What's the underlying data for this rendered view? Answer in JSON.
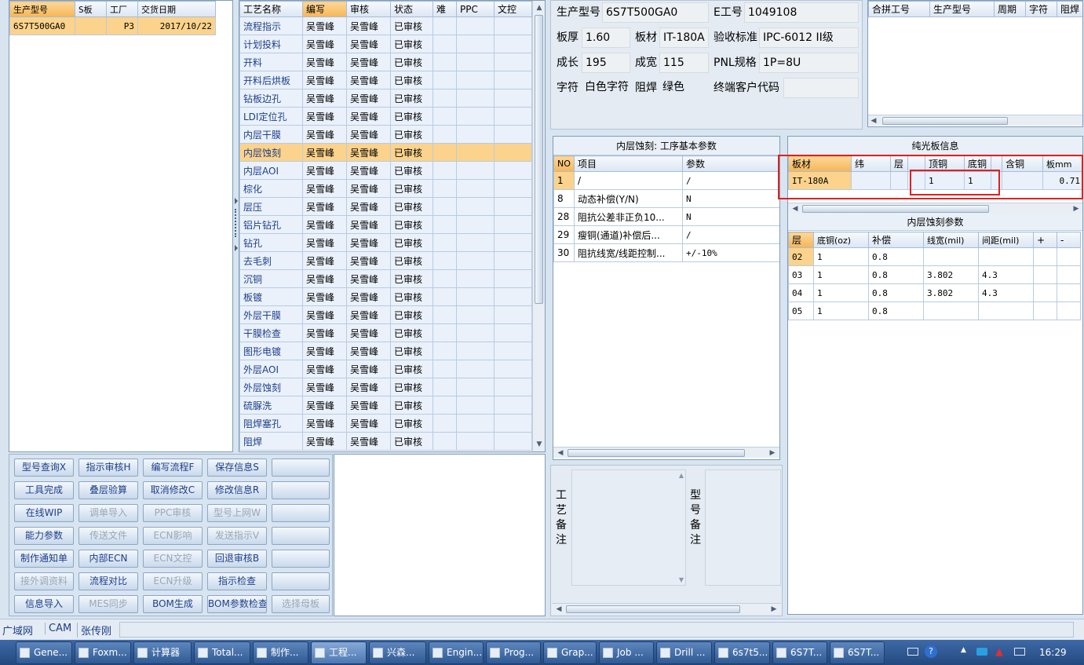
{
  "model_list": {
    "headers": [
      "生产型号",
      "S板",
      "工厂",
      "交货日期"
    ],
    "rows": [
      {
        "model": "6S7T500GA0",
        "s_board": "",
        "factory": "P3",
        "date": "2017/10/22"
      }
    ]
  },
  "process": {
    "headers": [
      "工艺名称",
      "编写",
      "审核",
      "状态",
      "难",
      "PPC",
      "文控"
    ],
    "rows": [
      {
        "name": "流程指示",
        "writer": "吴雪峰",
        "reviewer": "吴雪峰",
        "status": "已审核"
      },
      {
        "name": "计划投料",
        "writer": "吴雪峰",
        "reviewer": "吴雪峰",
        "status": "已审核"
      },
      {
        "name": "开料",
        "writer": "吴雪峰",
        "reviewer": "吴雪峰",
        "status": "已审核"
      },
      {
        "name": "开料后烘板",
        "writer": "吴雪峰",
        "reviewer": "吴雪峰",
        "status": "已审核"
      },
      {
        "name": "钻板边孔",
        "writer": "吴雪峰",
        "reviewer": "吴雪峰",
        "status": "已审核"
      },
      {
        "name": "LDI定位孔",
        "writer": "吴雪峰",
        "reviewer": "吴雪峰",
        "status": "已审核"
      },
      {
        "name": "内层干膜",
        "writer": "吴雪峰",
        "reviewer": "吴雪峰",
        "status": "已审核"
      },
      {
        "name": "内层蚀刻",
        "writer": "吴雪峰",
        "reviewer": "吴雪峰",
        "status": "已审核"
      },
      {
        "name": "内层AOI",
        "writer": "吴雪峰",
        "reviewer": "吴雪峰",
        "status": "已审核"
      },
      {
        "name": "棕化",
        "writer": "吴雪峰",
        "reviewer": "吴雪峰",
        "status": "已审核"
      },
      {
        "name": "层压",
        "writer": "吴雪峰",
        "reviewer": "吴雪峰",
        "status": "已审核"
      },
      {
        "name": "铝片钻孔",
        "writer": "吴雪峰",
        "reviewer": "吴雪峰",
        "status": "已审核"
      },
      {
        "name": "钻孔",
        "writer": "吴雪峰",
        "reviewer": "吴雪峰",
        "status": "已审核"
      },
      {
        "name": "去毛刺",
        "writer": "吴雪峰",
        "reviewer": "吴雪峰",
        "status": "已审核"
      },
      {
        "name": "沉铜",
        "writer": "吴雪峰",
        "reviewer": "吴雪峰",
        "status": "已审核"
      },
      {
        "name": "板镀",
        "writer": "吴雪峰",
        "reviewer": "吴雪峰",
        "status": "已审核"
      },
      {
        "name": "外层干膜",
        "writer": "吴雪峰",
        "reviewer": "吴雪峰",
        "status": "已审核"
      },
      {
        "name": "干膜检查",
        "writer": "吴雪峰",
        "reviewer": "吴雪峰",
        "status": "已审核"
      },
      {
        "name": "图形电镀",
        "writer": "吴雪峰",
        "reviewer": "吴雪峰",
        "status": "已审核"
      },
      {
        "name": "外层AOI",
        "writer": "吴雪峰",
        "reviewer": "吴雪峰",
        "status": "已审核"
      },
      {
        "name": "外层蚀刻",
        "writer": "吴雪峰",
        "reviewer": "吴雪峰",
        "status": "已审核"
      },
      {
        "name": "硫脲洗",
        "writer": "吴雪峰",
        "reviewer": "吴雪峰",
        "status": "已审核"
      },
      {
        "name": "阻焊塞孔",
        "writer": "吴雪峰",
        "reviewer": "吴雪峰",
        "status": "已审核"
      },
      {
        "name": "阻焊",
        "writer": "吴雪峰",
        "reviewer": "吴雪峰",
        "status": "已审核"
      }
    ]
  },
  "buttons": [
    [
      "型号查询X",
      "指示审核H",
      "编写流程F",
      "保存信息S",
      ""
    ],
    [
      "工具完成",
      "叠层验算",
      "取消修改C",
      "修改信息R",
      ""
    ],
    [
      "在线WIP",
      "调单导入",
      "PPC审核",
      "型号上网W",
      ""
    ],
    [
      "能力参数",
      "传送文件",
      "ECN影响",
      "发送指示V",
      ""
    ],
    [
      "制作通知单",
      "内部ECN",
      "ECN文控",
      "回退审核B",
      ""
    ],
    [
      "接外调资料",
      "流程对比",
      "ECN升级",
      "指示检查",
      ""
    ],
    [
      "信息导入",
      "MES同步",
      "BOM生成",
      "BOM参数检查",
      "选择母板"
    ]
  ],
  "info": {
    "prod_model_label": "生产型号",
    "prod_model": "6S7T500GA0",
    "e_no_label": "E工号",
    "e_no": "1049108",
    "thickness_label": "板厚",
    "thickness": "1.60",
    "material_label": "板材",
    "material": "IT-180A",
    "standard_label": "验收标准",
    "standard": "IPC-6012 II级",
    "length_label": "成长",
    "length": "195",
    "width_label": "成宽",
    "width": "115",
    "pnl_label": "PNL规格",
    "pnl": "1P=8U",
    "char_label": "字符",
    "char": "白色字符",
    "mask_label": "阻焊",
    "mask": "绿色",
    "customer_label": "终端客户代码",
    "customer": ""
  },
  "merge_table": {
    "headers": [
      "合拼工号",
      "生产型号",
      "周期",
      "字符",
      "阻焊"
    ]
  },
  "params": {
    "title": "内层蚀刻: 工序基本参数",
    "headers": [
      "NO",
      "项目",
      "参数"
    ],
    "rows": [
      {
        "no": "1",
        "item": "/",
        "value": "/"
      },
      {
        "no": "8",
        "item": "动态补偿(Y/N)",
        "value": "N"
      },
      {
        "no": "28",
        "item": "阻抗公差非正负10...",
        "value": "N"
      },
      {
        "no": "29",
        "item": "瘦铜(通道)补偿后...",
        "value": "/"
      },
      {
        "no": "30",
        "item": "阻抗线宽/线距控制...",
        "value": "+/-10%"
      }
    ]
  },
  "laminate": {
    "title": "纯光板信息",
    "headers": [
      "板材",
      "纬",
      "层",
      "",
      "顶铜",
      "底铜",
      "",
      "含铜",
      "板mm"
    ],
    "row": [
      "IT-180A",
      "",
      "",
      "",
      "1",
      "1",
      "",
      "",
      "0.71"
    ]
  },
  "etch": {
    "title": "内层蚀刻参数",
    "headers": [
      "层",
      "底铜(oz)",
      "补偿",
      "线宽(mil)",
      "间距(mil)",
      "+",
      "-"
    ],
    "rows": [
      [
        "02",
        "1",
        "0.8",
        "",
        "",
        "",
        ""
      ],
      [
        "03",
        "1",
        "0.8",
        "3.802",
        "4.3",
        "",
        ""
      ],
      [
        "04",
        "1",
        "0.8",
        "3.802",
        "4.3",
        "",
        ""
      ],
      [
        "05",
        "1",
        "0.8",
        "",
        "",
        "",
        ""
      ]
    ]
  },
  "remarks": {
    "process_label": "工艺备注",
    "model_label": "型号备注"
  },
  "status_bar": [
    "广域网",
    "CAM",
    "张传刚"
  ],
  "taskbar": {
    "items": [
      "Gene...",
      "Foxm...",
      "计算器",
      "Total...",
      "制作...",
      "工程...",
      "兴森...",
      "Engin...",
      "Prog...",
      "Grap...",
      "Job ...",
      "Drill ...",
      "6s7t5...",
      "6S7T...",
      "6S7T..."
    ],
    "clock": "16:29"
  }
}
